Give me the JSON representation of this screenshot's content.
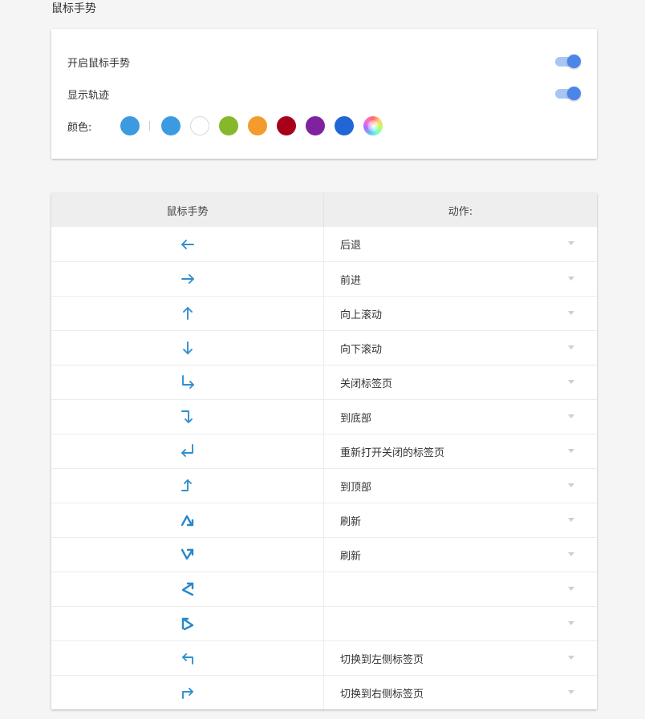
{
  "page": {
    "heading": "鼠标手势"
  },
  "settings": {
    "enable_gesture_label": "开启鼠标手势",
    "enable_gesture_on": true,
    "show_trail_label": "显示轨迹",
    "show_trail_on": true,
    "color_label": "颜色:",
    "current_color": "#3c9be0",
    "palette": [
      "#3c9be0",
      "#ffffff",
      "#85b82a",
      "#f39c2b",
      "#a8001b",
      "#7f22a0",
      "#2266d5",
      "rainbow"
    ]
  },
  "table": {
    "headers": {
      "gesture": "鼠标手势",
      "action": "动作:"
    },
    "rows": [
      {
        "gesture_icon": "arrow-left-icon",
        "action": "后退"
      },
      {
        "gesture_icon": "arrow-right-icon",
        "action": "前进"
      },
      {
        "gesture_icon": "arrow-up-icon",
        "action": "向上滚动"
      },
      {
        "gesture_icon": "arrow-down-icon",
        "action": "向下滚动"
      },
      {
        "gesture_icon": "down-right-icon",
        "action": "关闭标签页"
      },
      {
        "gesture_icon": "right-down-icon",
        "action": "到底部"
      },
      {
        "gesture_icon": "up-left-icon",
        "action": "重新打开关闭的标签页"
      },
      {
        "gesture_icon": "right-up-icon",
        "action": "到顶部"
      },
      {
        "gesture_icon": "up-down-icon",
        "action": "刷新"
      },
      {
        "gesture_icon": "down-up-icon",
        "action": "刷新"
      },
      {
        "gesture_icon": "left-downleft-right-icon",
        "action": ""
      },
      {
        "gesture_icon": "up-downright-left-icon",
        "action": ""
      },
      {
        "gesture_icon": "down-left-icon",
        "action": "切换到左侧标签页"
      },
      {
        "gesture_icon": "up-right-icon",
        "action": "切换到右侧标签页"
      }
    ]
  }
}
